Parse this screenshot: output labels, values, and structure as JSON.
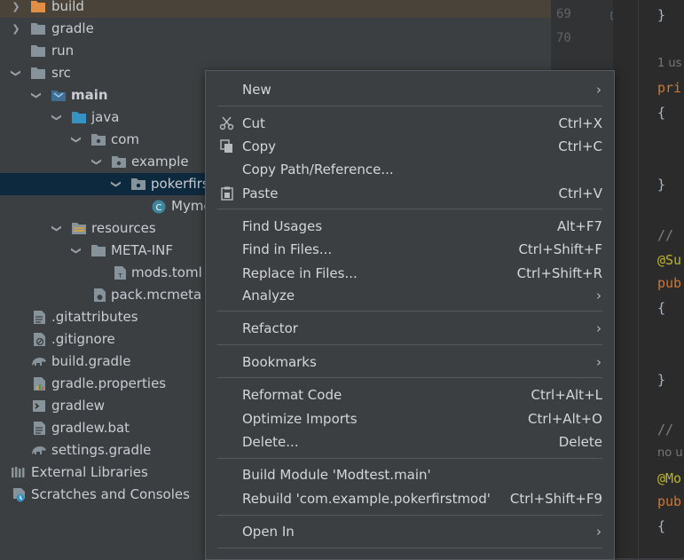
{
  "tree": {
    "items": [
      {
        "label": "build",
        "icon": "folder-icon",
        "expanded": false
      },
      {
        "label": "gradle",
        "icon": "folder-icon",
        "expanded": false
      },
      {
        "label": "run",
        "icon": "folder-icon"
      },
      {
        "label": "src",
        "icon": "folder-icon",
        "expanded": true
      },
      {
        "label": "main",
        "icon": "source-root-icon",
        "expanded": true
      },
      {
        "label": "java",
        "icon": "source-folder-icon",
        "expanded": true
      },
      {
        "label": "com",
        "icon": "package-icon",
        "expanded": true
      },
      {
        "label": "example",
        "icon": "package-icon",
        "expanded": true
      },
      {
        "label": "pokerfirst",
        "icon": "package-icon",
        "expanded": true,
        "selected": true
      },
      {
        "label": "Mymo",
        "icon": "class-icon"
      },
      {
        "label": "resources",
        "icon": "resources-folder-icon",
        "expanded": true
      },
      {
        "label": "META-INF",
        "icon": "folder-icon",
        "expanded": true
      },
      {
        "label": "mods.toml",
        "icon": "toml-file-icon"
      },
      {
        "label": "pack.mcmeta",
        "icon": "mcmeta-file-icon"
      },
      {
        "label": ".gitattributes",
        "icon": "text-file-icon"
      },
      {
        "label": ".gitignore",
        "icon": "gitignore-file-icon"
      },
      {
        "label": "build.gradle",
        "icon": "gradle-elephant-icon"
      },
      {
        "label": "gradle.properties",
        "icon": "properties-file-icon"
      },
      {
        "label": "gradlew",
        "icon": "shell-script-icon"
      },
      {
        "label": "gradlew.bat",
        "icon": "text-file-icon"
      },
      {
        "label": "settings.gradle",
        "icon": "gradle-elephant-icon"
      },
      {
        "label": "External Libraries",
        "icon": "libraries-icon",
        "expanded": false
      },
      {
        "label": "Scratches and Consoles",
        "icon": "scratches-icon"
      }
    ]
  },
  "gutter": {
    "line_numbers": [
      "69",
      "70"
    ]
  },
  "editor": {
    "lines": [
      "}",
      "1 us",
      "pri",
      "{",
      "}",
      "//",
      "@Su",
      "pub",
      "{",
      "}",
      "//",
      "no u",
      "@Mo",
      "pub",
      "{"
    ]
  },
  "context_menu": {
    "items": [
      {
        "label": "New",
        "submenu": true
      },
      {
        "label": "Cut",
        "shortcut": "Ctrl+X",
        "icon": "scissors-icon"
      },
      {
        "label": "Copy",
        "shortcut": "Ctrl+C",
        "icon": "copy-icon"
      },
      {
        "label": "Copy Path/Reference..."
      },
      {
        "label": "Paste",
        "shortcut": "Ctrl+V",
        "icon": "paste-icon"
      },
      {
        "label": "Find Usages",
        "shortcut": "Alt+F7"
      },
      {
        "label": "Find in Files...",
        "shortcut": "Ctrl+Shift+F"
      },
      {
        "label": "Replace in Files...",
        "shortcut": "Ctrl+Shift+R"
      },
      {
        "label": "Analyze",
        "submenu": true
      },
      {
        "label": "Refactor",
        "submenu": true
      },
      {
        "label": "Bookmarks",
        "submenu": true
      },
      {
        "label": "Reformat Code",
        "shortcut": "Ctrl+Alt+L"
      },
      {
        "label": "Optimize Imports",
        "shortcut": "Ctrl+Alt+O"
      },
      {
        "label": "Delete...",
        "shortcut": "Delete"
      },
      {
        "label": "Build Module 'Modtest.main'"
      },
      {
        "label": "Rebuild 'com.example.pokerfirstmod'",
        "shortcut": "Ctrl+Shift+F9"
      },
      {
        "label": "Open In",
        "submenu": true
      }
    ],
    "submenu_arrow": "›"
  },
  "colors": {
    "background": "#3c3f41",
    "selection": "#0d293e",
    "folder": "#87939a",
    "source_folder": "#3592c4",
    "keyword": "#cc7832",
    "annotation": "#bbb529"
  }
}
